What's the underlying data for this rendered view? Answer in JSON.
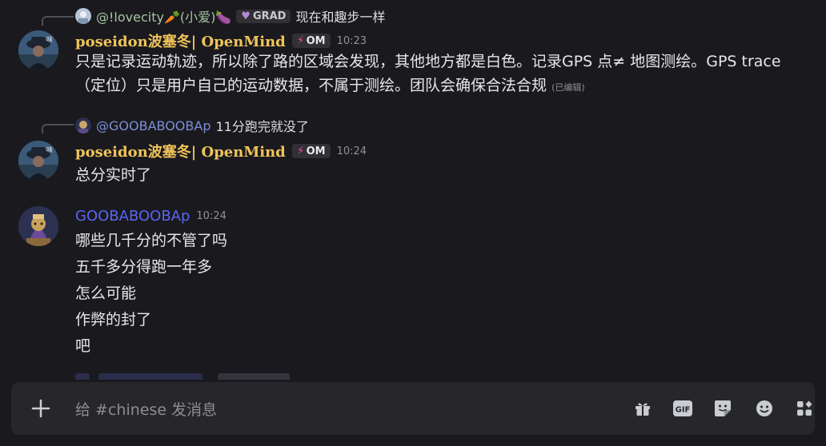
{
  "messages": [
    {
      "reply": {
        "name": "@!lovecity🥕(小爱)🍆",
        "tag": "GRAD",
        "text": "现在和趣步一样"
      },
      "author": "poseidon波塞冬| OpenMind",
      "badge": "OM",
      "time": "10:23",
      "text": "只是记录运动轨迹，所以除了路的区域会发现，其他地方都是白色。记录GPS 点≠ 地图测绘。GPS trace（定位）只是用户自己的运动数据，不属于测绘。团队会确保合法合规",
      "edited": "(已编辑)"
    },
    {
      "reply": {
        "name": "@GOOBABOOBAp",
        "text": "11分跑完就没了"
      },
      "author": "poseidon波塞冬| OpenMind",
      "badge": "OM",
      "time": "10:24",
      "text": "总分实时了"
    },
    {
      "author": "GOOBABOOBAp",
      "time": "10:24",
      "lines": [
        "哪些几千分的不管了吗",
        "五千多分得跑一年多",
        "怎么可能",
        "作弊的封了",
        "吧"
      ]
    }
  ],
  "composer": {
    "placeholder": "给 #chinese 发消息",
    "gif_label": "GIF",
    "icons": [
      "plus-icon",
      "gift-icon",
      "gif-icon",
      "sticker-icon",
      "emoji-icon",
      "apps-icon"
    ]
  },
  "colors": {
    "background": "#1a1a1e",
    "composer": "#26262b",
    "gold_name": "#f0c45a",
    "blue_name": "#5865f2"
  }
}
